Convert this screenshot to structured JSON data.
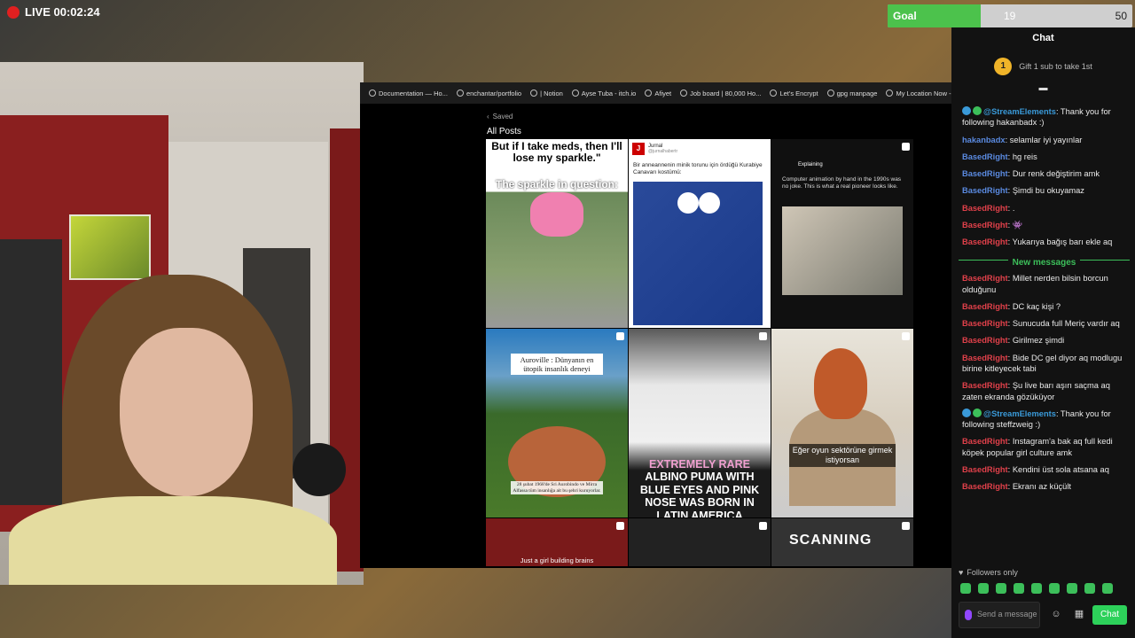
{
  "live": {
    "text": "LIVE 00:02:24",
    "color": "#e02020"
  },
  "goal": {
    "label": "Goal",
    "current": "19",
    "target": "50",
    "progress": 0.38,
    "fill_color": "#4cc24c"
  },
  "browser": {
    "bookmarks": [
      "Documentation — Ho...",
      "enchantar/portfolio",
      "| Notion",
      "Ayse Tuba - itch.io",
      "Afiyet",
      "Job board | 80,000 Ho...",
      "Let's Encrypt",
      "gpg manpage",
      "My Location Now - W..."
    ],
    "back_label": "Saved",
    "page_title": "All Posts",
    "posts": {
      "p1_caption": "But if I take meds, then I'll lose my sparkle.\"",
      "p1_caption2": "The sparkle in question:",
      "p2_account": "Jurnal",
      "p2_handle": "@jurnalhabertr",
      "p2_logo": "J",
      "p2_body": "Bir anneannenin minik torunu için ördüğü Kurabiye Canavarı kostümü:",
      "p3_brand": "Explaining",
      "p3_body": "Computer animation by hand in the 1990s was no joke. This is what a real pioneer looks like.",
      "p4_title": "Auroville : Dünyanın en ütopik insanlık deneyi",
      "p4_footer": "28 şubat 1968'de Sri Aurobindo ve Mirra Alfassa tüm insanlığa ait bu şehri kuruyorlar.",
      "p5_caption_hl": "EXTREMELY RARE",
      "p5_caption": "ALBINO PUMA WITH BLUE EYES AND PINK NOSE WAS BORN IN LATIN AMERICA",
      "p6_caption": "Eğer oyun sektörüne girmek istiyorsan",
      "p7_caption": "Just a girl building brains",
      "p9_caption": "SCANNING"
    }
  },
  "chat": {
    "title": "Chat",
    "gift_rank": "1",
    "gift_text": "Gift 1 sub to take 1st",
    "messages_before": [
      {
        "user": "@StreamElements",
        "color": "#3a9ad9",
        "text": ": Thank you for following hakanbadx :)",
        "bot": true
      },
      {
        "user": "hakanbadx",
        "color": "#5a8ae0",
        "text": ": selamlar iyi yayınlar"
      },
      {
        "user": "BasedRight",
        "color": "#5a8ae0",
        "text": ": hg reis"
      },
      {
        "user": "BasedRight",
        "color": "#5a8ae0",
        "text": ": Dur renk değiştirim amk"
      },
      {
        "user": "BasedRight",
        "color": "#5a8ae0",
        "text": ": Şimdi bu okuyamaz"
      },
      {
        "user": "BasedRight",
        "color": "#e0404a",
        "text": ": ."
      },
      {
        "user": "BasedRight",
        "color": "#e0404a",
        "text": ": 👾"
      },
      {
        "user": "BasedRight",
        "color": "#e0404a",
        "text": ": Yukarıya bağış barı ekle aq"
      }
    ],
    "divider_label": "New messages",
    "messages_after": [
      {
        "user": "BasedRight",
        "color": "#e0404a",
        "text": ": Millet nerden bilsin borcun olduğunu"
      },
      {
        "user": "BasedRight",
        "color": "#e0404a",
        "text": ": DC kaç kişi ?"
      },
      {
        "user": "BasedRight",
        "color": "#e0404a",
        "text": ": Sunucuda full Meriç vardır aq"
      },
      {
        "user": "BasedRight",
        "color": "#e0404a",
        "text": ": Girilmez şimdi"
      },
      {
        "user": "BasedRight",
        "color": "#e0404a",
        "text": ": Bide DC gel diyor aq modlugu birine kitleyecek tabi"
      },
      {
        "user": "BasedRight",
        "color": "#e0404a",
        "text": ": Şu live barı aşırı saçma aq zaten ekranda gözüküyor"
      },
      {
        "user": "@StreamElements",
        "color": "#3a9ad9",
        "text": ": Thank you for following steffzweig :)",
        "bot": true
      },
      {
        "user": "BasedRight",
        "color": "#e0404a",
        "text": ": Instagram'a bak aq full kedi köpek popular girl culture amk"
      },
      {
        "user": "BasedRight",
        "color": "#e0404a",
        "text": ": Kendini üst sola atsana aq"
      },
      {
        "user": "BasedRight",
        "color": "#e0404a",
        "text": ": Ekranı az küçült"
      }
    ],
    "followers_label": "Followers only",
    "input_placeholder": "Send a message",
    "send_label": "Chat"
  }
}
